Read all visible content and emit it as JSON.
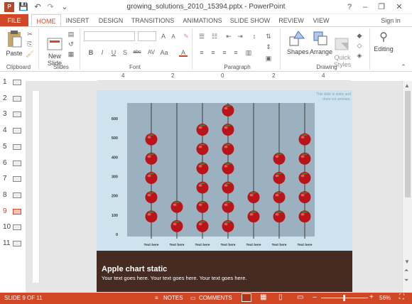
{
  "window": {
    "title": "growing_solutions_2010_15394.pptx - PowerPoint",
    "help": "?",
    "minimize": "–",
    "restore": "❐",
    "close": "✕",
    "sign_in": "Sign in"
  },
  "quick_access": {
    "save_icon": "save-icon",
    "undo_icon": "undo-icon",
    "redo_icon": "redo-icon",
    "customize_icon": "customize-icon"
  },
  "tabs": [
    "FILE",
    "HOME",
    "INSERT",
    "DESIGN",
    "TRANSITIONS",
    "ANIMATIONS",
    "SLIDE SHOW",
    "REVIEW",
    "VIEW"
  ],
  "ribbon": {
    "paste": "Paste",
    "new_slide": "New\nSlide",
    "shapes": "Shapes",
    "arrange": "Arrange",
    "quick_styles": "Quick\nStyles",
    "editing": "Editing",
    "groups": {
      "clipboard": "Clipboard",
      "slides": "Slides",
      "font": "Font",
      "paragraph": "Paragraph",
      "drawing": "Drawing"
    },
    "font_buttons": [
      "B",
      "I",
      "U",
      "S",
      "abc",
      "AV",
      "Aa",
      "A"
    ],
    "font_grow": "A",
    "font_shrink": "A"
  },
  "ruler": {
    "h_numbers": [
      "4",
      "2",
      "0",
      "2",
      "4"
    ]
  },
  "thumbnails": {
    "numbers": [
      "1",
      "2",
      "3",
      "4",
      "5",
      "6",
      "7",
      "8",
      "9",
      "10",
      "11"
    ],
    "selected": "9"
  },
  "slide": {
    "note": "This slide is static and\ndoes not animate.",
    "y_ticks": [
      "600",
      "500",
      "400",
      "300",
      "200",
      "100",
      "0"
    ],
    "x_labels": [
      "Text here",
      "Text here",
      "Text here",
      "Text here",
      "Text here",
      "Text here",
      "Text here"
    ],
    "title": "Apple chart static",
    "body": "Your text goes here. Your text goes here. Your text goes here."
  },
  "chart_data": {
    "type": "bar",
    "categories": [
      "Text here",
      "Text here",
      "Text here",
      "Text here",
      "Text here",
      "Text here",
      "Text here"
    ],
    "values": [
      500,
      150,
      550,
      650,
      200,
      400,
      500
    ],
    "ylim": [
      0,
      600
    ],
    "title": "",
    "xlabel": "",
    "ylabel": "",
    "colors": {
      "apple": "#b8141a",
      "background": "#9cb1c0"
    }
  },
  "status": {
    "slide": "SLIDE 9 OF 11",
    "notes": "NOTES",
    "comments": "COMMENTS",
    "zoom": "56%",
    "minus": "–",
    "plus": "+"
  }
}
